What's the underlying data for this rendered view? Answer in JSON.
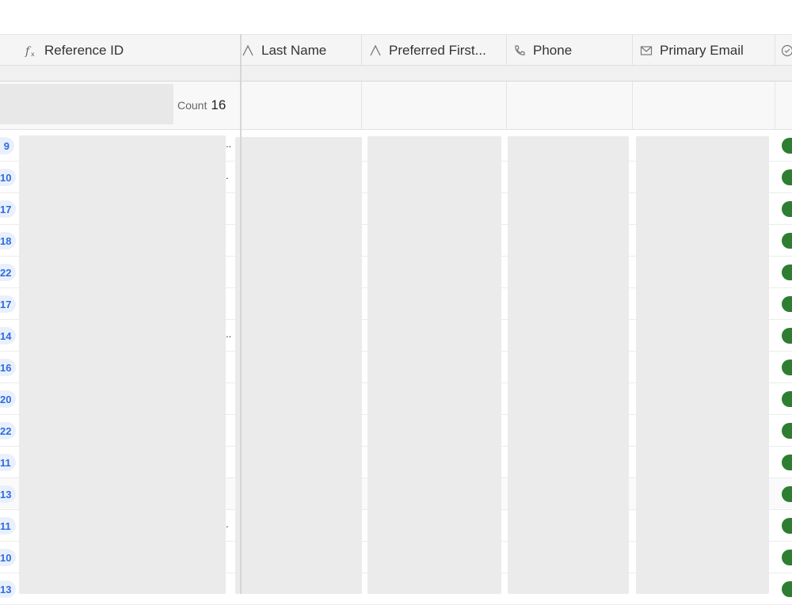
{
  "columns": [
    {
      "label": "Reference ID",
      "icon": "formula-icon"
    },
    {
      "label": "Last Name",
      "icon": "text-icon"
    },
    {
      "label": "Preferred First...",
      "icon": "text-icon"
    },
    {
      "label": "Phone",
      "icon": "phone-icon"
    },
    {
      "label": "Primary Email",
      "icon": "email-icon"
    },
    {
      "label": "",
      "icon": "status-field-icon"
    }
  ],
  "summary": {
    "count_label": "Count",
    "count_value": "16"
  },
  "rows": [
    {
      "num": "9",
      "ellipsis": ".."
    },
    {
      "num": "10",
      "ellipsis": "."
    },
    {
      "num": "17",
      "ellipsis": ""
    },
    {
      "num": "18",
      "ellipsis": ""
    },
    {
      "num": "22",
      "ellipsis": ""
    },
    {
      "num": "17",
      "ellipsis": ""
    },
    {
      "num": "14",
      "ellipsis": ".."
    },
    {
      "num": "16",
      "ellipsis": ""
    },
    {
      "num": "20",
      "ellipsis": ""
    },
    {
      "num": "22",
      "ellipsis": ""
    },
    {
      "num": "11",
      "ellipsis": ""
    },
    {
      "num": "13",
      "ellipsis": ""
    },
    {
      "num": "11",
      "ellipsis": "."
    },
    {
      "num": "10",
      "ellipsis": ""
    },
    {
      "num": "13",
      "ellipsis": ""
    }
  ],
  "colors": {
    "link_blue": "#2d6cdf",
    "pill_bg": "#eaf0fb",
    "status_green": "#2f7d32"
  }
}
